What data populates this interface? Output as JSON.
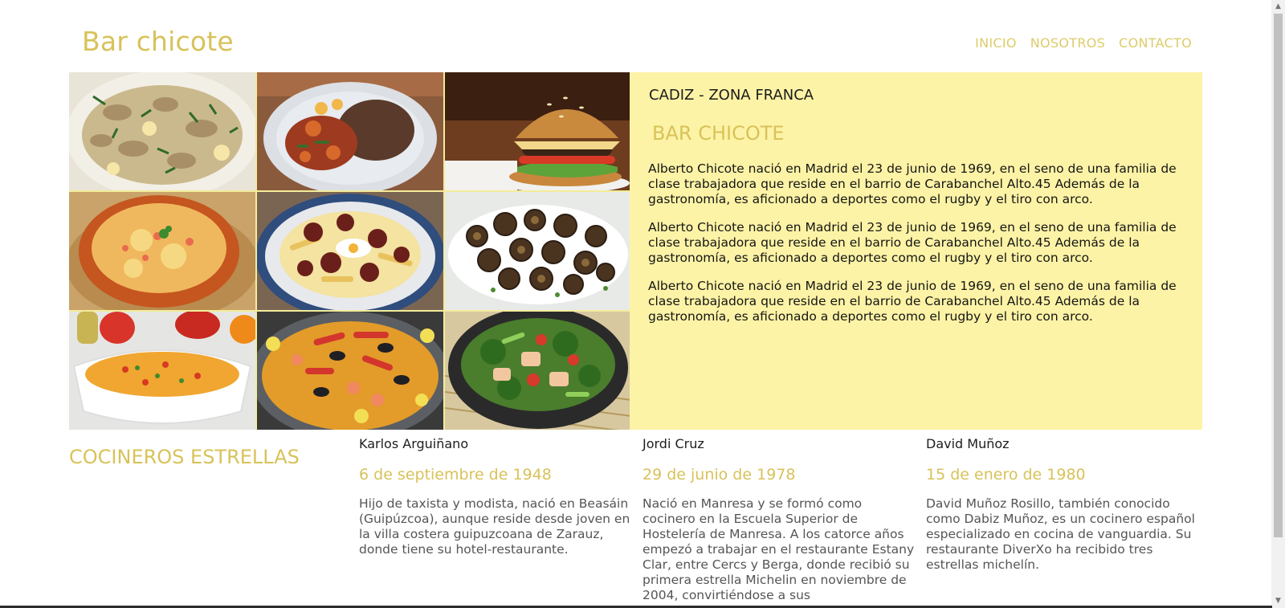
{
  "header": {
    "logo": "Bar chicote",
    "nav": [
      "INICIO",
      "NOSOTROS",
      "CONTACTO"
    ]
  },
  "gallery": {
    "images": [
      "mushroom-scrambled-eggs-photo",
      "rice-and-peppers-plate-photo",
      "burger-photo",
      "salmorejo-bowl-photo",
      "eggs-chorizo-fries-photo",
      "snails-plate-photo",
      "vegetable-rice-photo",
      "seafood-paella-photo",
      "stir-fry-vegetables-photo"
    ]
  },
  "info": {
    "location": "CADIZ - ZONA FRANCA",
    "title": "BAR CHICOTE",
    "paragraphs": [
      "Alberto Chicote nació en Madrid el 23 de junio de 1969, en el seno de una familia de clase trabajadora que reside en el barrio de Carabanchel Alto.45 Además de la gastronomía, es aficionado a deportes como el rugby y el tiro con arco.",
      "Alberto Chicote nació en Madrid el 23 de junio de 1969, en el seno de una familia de clase trabajadora que reside en el barrio de Carabanchel Alto.45 Además de la gastronomía, es aficionado a deportes como el rugby y el tiro con arco.",
      "Alberto Chicote nació en Madrid el 23 de junio de 1969, en el seno de una familia de clase trabajadora que reside en el barrio de Carabanchel Alto.45 Además de la gastronomía, es aficionado a deportes como el rugby y el tiro con arco."
    ]
  },
  "chefs": {
    "heading": "COCINEROS ESTRELLAS",
    "items": [
      {
        "name": "Karlos Arguiñano",
        "date": "6 de septiembre de 1948",
        "bio": "Hijo de taxista y modista, nació en Beasáin (Guipúzcoa), aunque reside desde joven en la villa costera guipuzcoana de Zarauz, donde tiene su hotel-restaurante."
      },
      {
        "name": "Jordi Cruz",
        "date": "29 de junio de 1978",
        "bio": "Nació en Manresa y se formó como cocinero en la Escuela Superior de Hostelería de Manresa. A los catorce años empezó a trabajar en el restaurante Estany Clar, entre Cercs y Berga, donde recibió su primera estrella Michelin en noviembre de 2004, convirtiéndose a sus"
      },
      {
        "name": "David Muñoz",
        "date": "15 de enero de 1980",
        "bio": "David Muñoz Rosillo, también conocido como Dabiz Muñoz, es un cocinero español especializado en cocina de vanguardia. Su restaurante DiverXo ha recibido tres estrellas michelín."
      }
    ]
  },
  "colors": {
    "accent": "#d8c25a",
    "panel": "#fdf3a6",
    "text": "#151515"
  }
}
